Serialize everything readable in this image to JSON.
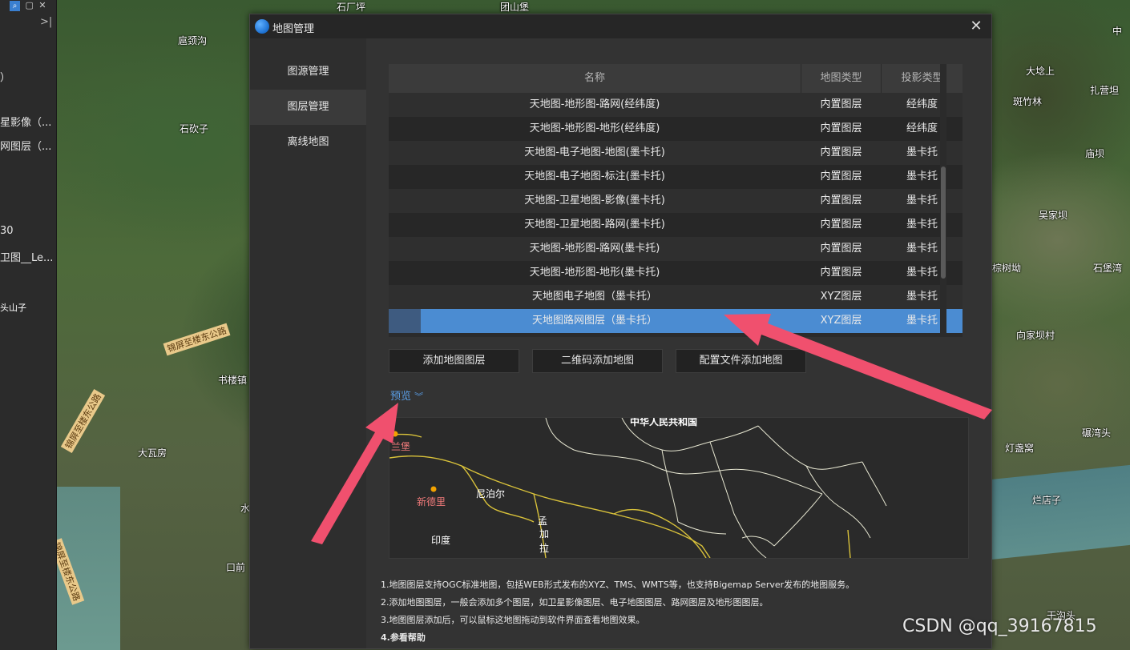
{
  "background_map": {
    "labels": [
      "石厂坪",
      "团山堡",
      "扈颈沟",
      "石砍子",
      "大瓦房",
      "大埝上",
      "斑竹林",
      "扎营坦",
      "庙坝",
      "吴家坝",
      "石堡湾",
      "棕树坳",
      "向家坝村",
      "灯盏窝",
      "碾湾头",
      "烂店子",
      "干沟头",
      "中",
      "水",
      "口前",
      "书楼镇"
    ],
    "road_labels": [
      "锦屏至楼东公路",
      "锦屏至楼东公路",
      "锦屏至楼东公路"
    ]
  },
  "left_panel": {
    "items": [
      "）",
      "星影像（...",
      "网图层（...",
      "30",
      "卫图__Le...",
      "头山子"
    ],
    "tool_icons": [
      "search-icon",
      "copy-icon",
      "close-icon"
    ],
    "collapse_glyph": ">|"
  },
  "dialog": {
    "title": "地图管理",
    "close_glyph": "✕",
    "nav": [
      {
        "label": "图源管理",
        "active": false
      },
      {
        "label": "图层管理",
        "active": true
      },
      {
        "label": "离线地图",
        "active": false
      }
    ],
    "table": {
      "headers": [
        "名称",
        "地图类型",
        "投影类型"
      ],
      "rows": [
        {
          "name": "天地图-地形图-路网(经纬度)",
          "type": "内置图层",
          "proj": "经纬度"
        },
        {
          "name": "天地图-地形图-地形(经纬度)",
          "type": "内置图层",
          "proj": "经纬度"
        },
        {
          "name": "天地图-电子地图-地图(墨卡托)",
          "type": "内置图层",
          "proj": "墨卡托"
        },
        {
          "name": "天地图-电子地图-标注(墨卡托)",
          "type": "内置图层",
          "proj": "墨卡托"
        },
        {
          "name": "天地图-卫星地图-影像(墨卡托)",
          "type": "内置图层",
          "proj": "墨卡托"
        },
        {
          "name": "天地图-卫星地图-路网(墨卡托)",
          "type": "内置图层",
          "proj": "墨卡托"
        },
        {
          "name": "天地图-地形图-路网(墨卡托)",
          "type": "内置图层",
          "proj": "墨卡托"
        },
        {
          "name": "天地图-地形图-地形(墨卡托)",
          "type": "内置图层",
          "proj": "墨卡托"
        },
        {
          "name": "天地图电子地图（墨卡托）",
          "type": "XYZ图层",
          "proj": "墨卡托"
        },
        {
          "name": "天地图路网图层（墨卡托）",
          "type": "XYZ图层",
          "proj": "墨卡托",
          "selected": true
        }
      ]
    },
    "buttons": {
      "add_layer": "添加地图图层",
      "qr_add": "二维码添加地图",
      "config_add": "配置文件添加地图"
    },
    "preview": {
      "label": "预览",
      "map_labels": [
        "中华人民共和国",
        "兰堡",
        "新德里",
        "尼泊尔",
        "印度",
        "孟",
        "加",
        "拉"
      ]
    },
    "notes": [
      "1.地图图层支持OGC标准地图，包括WEB形式发布的XYZ、TMS、WMTS等，也支持Bigemap Server发布的地图服务。",
      "2.添加地图图层，一般会添加多个图层，如卫星影像图层、电子地图图层、路网图层及地形图图层。",
      "3.地图图层添加后，可以鼠标这地图拖动到软件界面查看地图效果。",
      "4.参看帮助"
    ]
  },
  "watermark": "CSDN @qq_39167815",
  "colors": {
    "accent": "#4b8cd2",
    "arrow": "#f0506e",
    "preview_link": "#5a9ee6"
  }
}
